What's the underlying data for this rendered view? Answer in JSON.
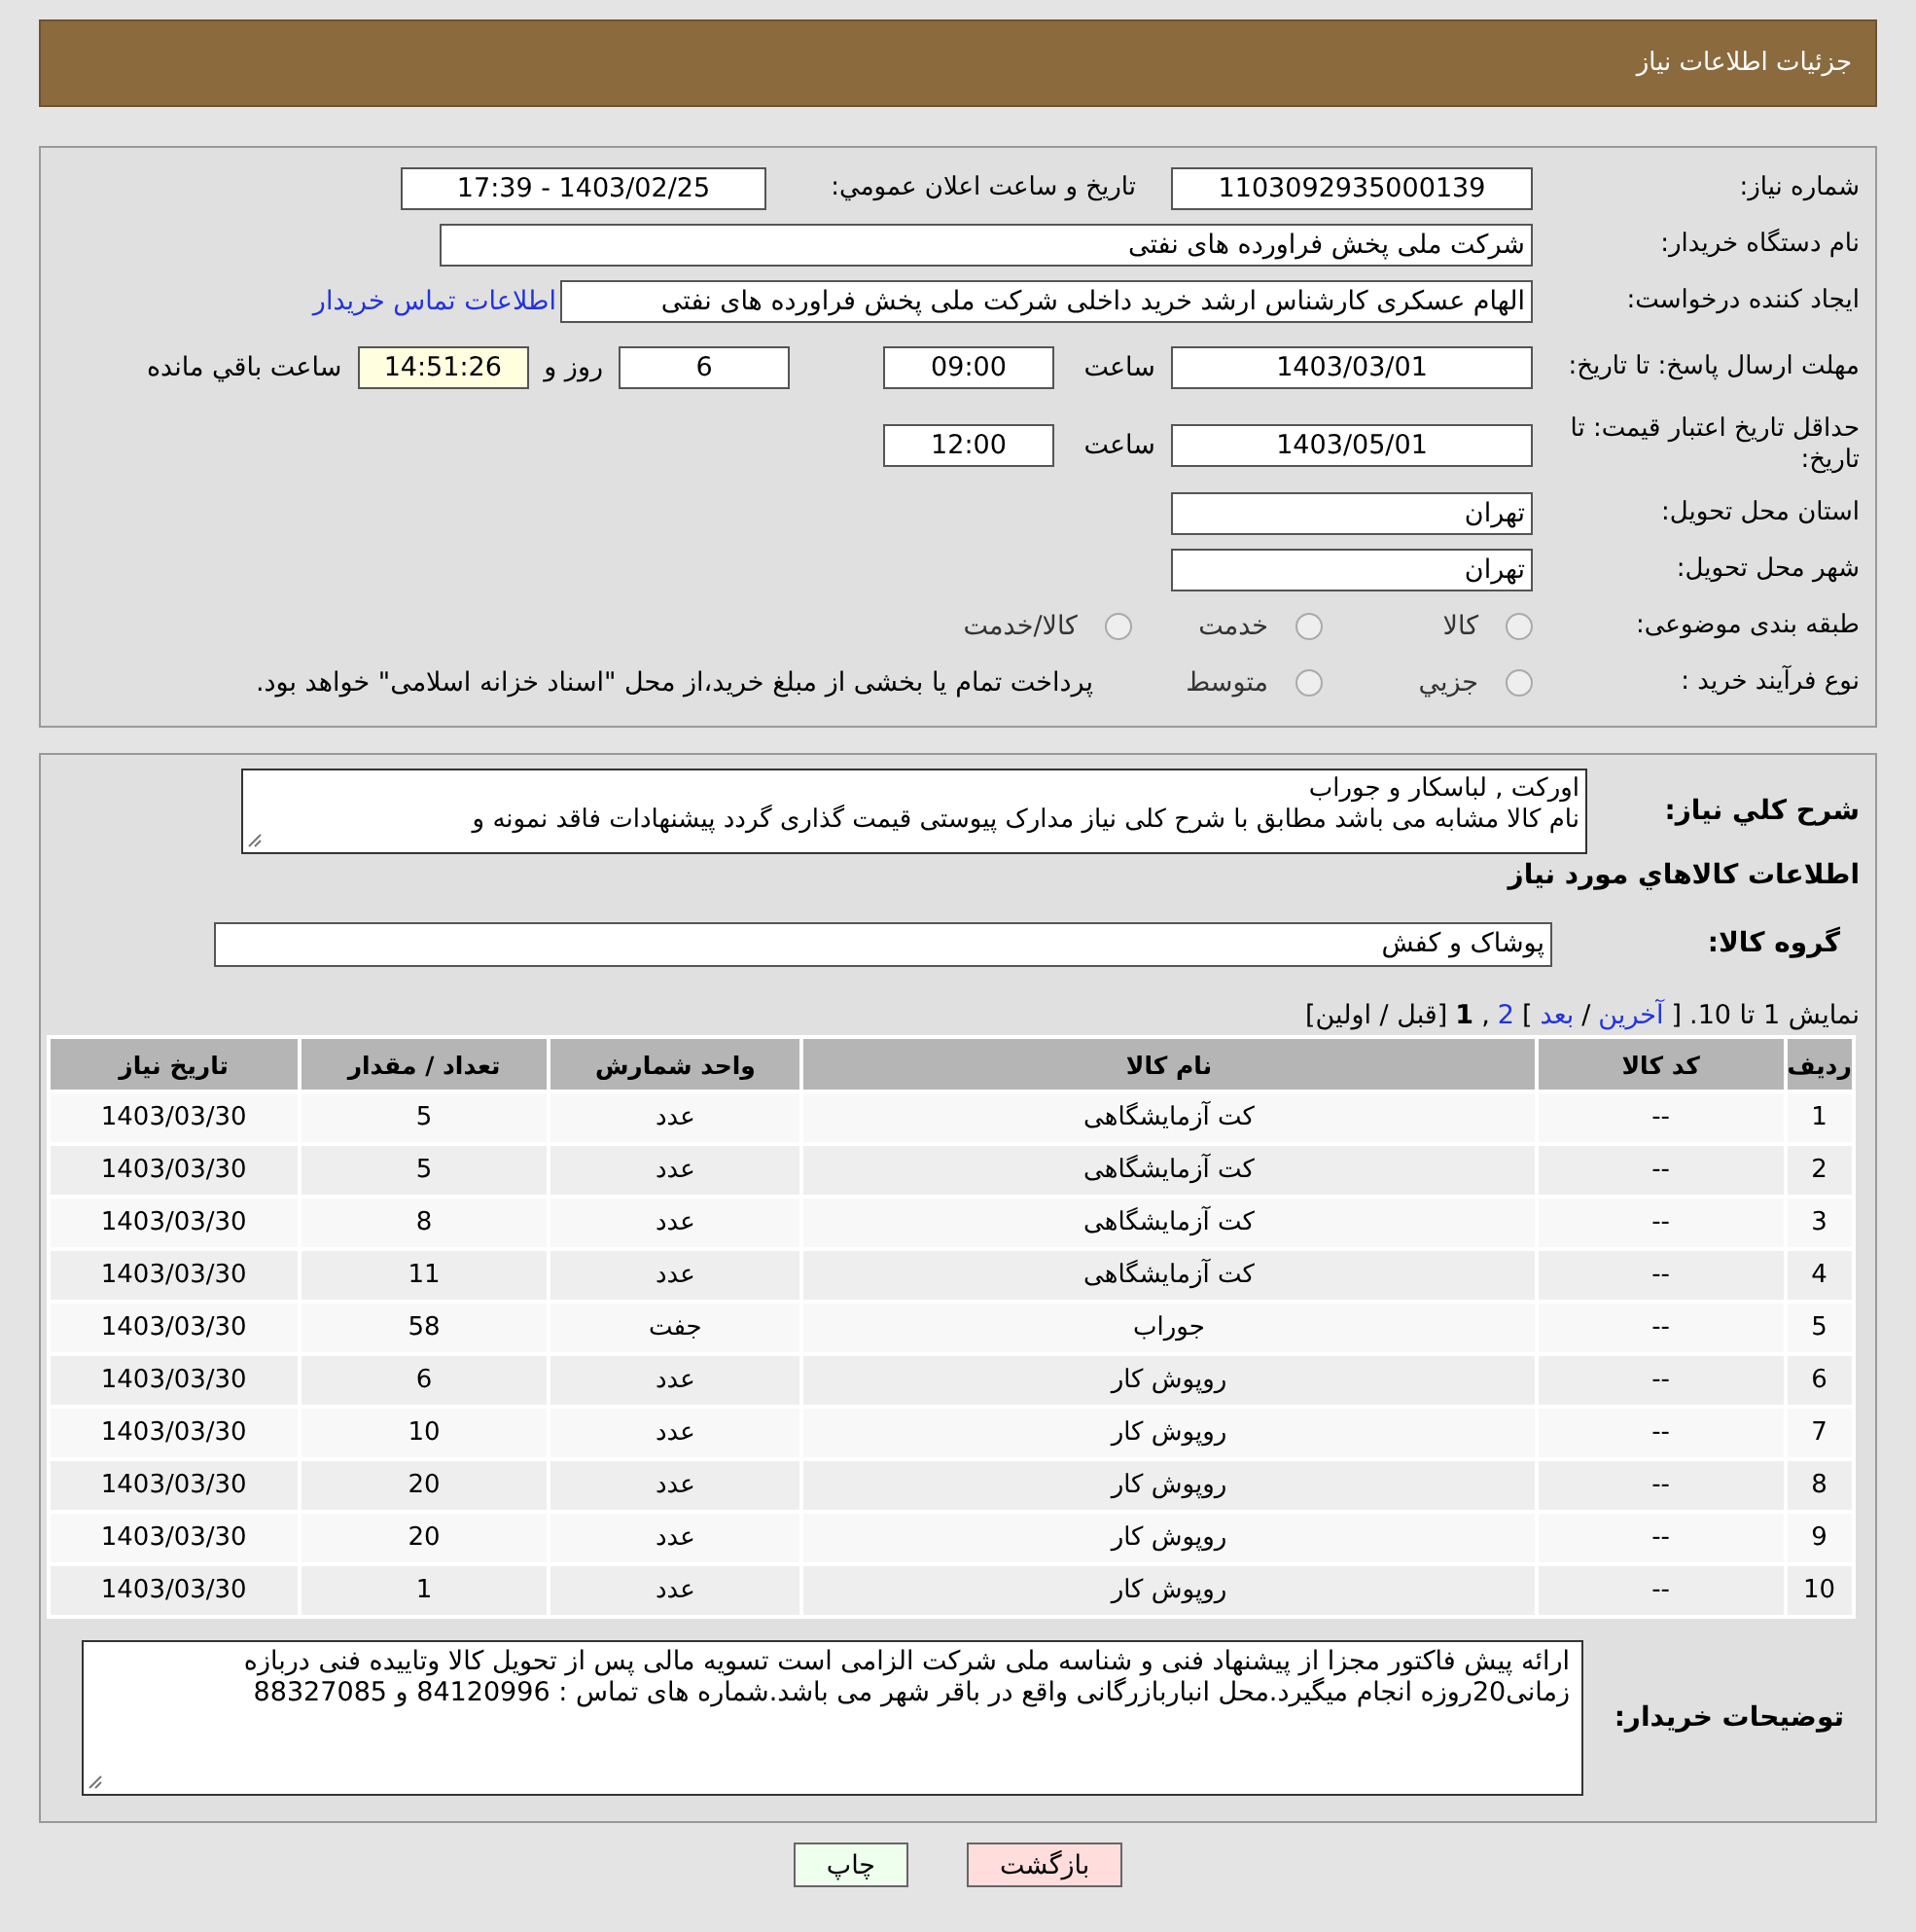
{
  "header": {
    "title": "جزئیات اطلاعات نیاز"
  },
  "details": {
    "need_number": {
      "label": "شماره نیاز:",
      "value": "1103092935000139"
    },
    "announce": {
      "label": "تاریخ و ساعت اعلان عمومي:",
      "value": "1403/02/25 - 17:39"
    },
    "buyer_org": {
      "label": "نام دستگاه خریدار:",
      "value": "شرکت ملی پخش فراورده های نفتی"
    },
    "creator": {
      "label": "ایجاد کننده درخواست:",
      "value": "الهام عسکری کارشناس ارشد خرید داخلی شرکت ملی پخش فراورده های نفتی",
      "link": "اطلاعات تماس خریدار"
    },
    "reply_deadline": {
      "label": "مهلت ارسال پاسخ: تا تاریخ:",
      "date": "1403/03/01",
      "time_label": "ساعت",
      "time": "09:00",
      "days": "6",
      "days_label": "روز و",
      "remaining": "14:51:26",
      "remaining_label": "ساعت باقي مانده"
    },
    "price_validity": {
      "label": "حداقل تاریخ اعتبار قیمت: تا تاریخ:",
      "date": "1403/05/01",
      "time_label": "ساعت",
      "time": "12:00"
    },
    "province": {
      "label": "استان محل تحویل:",
      "value": "تهران"
    },
    "city": {
      "label": "شهر محل تحویل:",
      "value": "تهران"
    },
    "category": {
      "label": "طبقه بندی موضوعی:",
      "options": [
        {
          "label": "کالا",
          "selected": false
        },
        {
          "label": "خدمت",
          "selected": false
        },
        {
          "label": "کالا/خدمت",
          "selected": false
        }
      ]
    },
    "purchase_type": {
      "label": "نوع فرآیند خرید :",
      "options": [
        {
          "label": "جزيي",
          "selected": false
        },
        {
          "label": "متوسط",
          "selected": false
        }
      ],
      "note": "پرداخت تمام یا بخشی از مبلغ خرید،از محل \"اسناد خزانه اسلامی\" خواهد بود."
    }
  },
  "items_section": {
    "summary": {
      "label": "شرح کلي نیاز:",
      "lines": [
        "اورکت , لباسکار و جوراب",
        "نام کالا مشابه می باشد مطابق با شرح کلی نیاز مدارک پیوستی قیمت گذاری گردد پیشنهادات فاقد نمونه و"
      ]
    },
    "title": "اطلاعات کالاهاي مورد نیاز",
    "group": {
      "label": "گروه کالا:",
      "value": "پوشاک و کفش"
    },
    "pagination": [
      {
        "text": "نمایش 1 تا 10.",
        "kind": "plain"
      },
      {
        "text": "[",
        "kind": "plain"
      },
      {
        "text": "آخرین",
        "kind": "link"
      },
      {
        "text": "/",
        "kind": "plain"
      },
      {
        "text": "بعد",
        "kind": "link"
      },
      {
        "text": "]",
        "kind": "plain"
      },
      {
        "text": "2",
        "kind": "link"
      },
      {
        "text": ",",
        "kind": "plain"
      },
      {
        "text": "1",
        "kind": "current"
      },
      {
        "text": "[قبل / اولین]",
        "kind": "plain"
      }
    ],
    "table": {
      "columns": [
        "ردیف",
        "کد کالا",
        "نام کالا",
        "واحد شمارش",
        "تعداد / مقدار",
        "تاریخ نیاز"
      ],
      "rows": [
        [
          "1",
          "--",
          "کت آزمایشگاهی",
          "عدد",
          "5",
          "1403/03/30"
        ],
        [
          "2",
          "--",
          "کت آزمایشگاهی",
          "عدد",
          "5",
          "1403/03/30"
        ],
        [
          "3",
          "--",
          "کت آزمایشگاهی",
          "عدد",
          "8",
          "1403/03/30"
        ],
        [
          "4",
          "--",
          "کت آزمایشگاهی",
          "عدد",
          "11",
          "1403/03/30"
        ],
        [
          "5",
          "--",
          "جوراب",
          "جفت",
          "58",
          "1403/03/30"
        ],
        [
          "6",
          "--",
          "روپوش کار",
          "عدد",
          "6",
          "1403/03/30"
        ],
        [
          "7",
          "--",
          "روپوش کار",
          "عدد",
          "10",
          "1403/03/30"
        ],
        [
          "8",
          "--",
          "روپوش کار",
          "عدد",
          "20",
          "1403/03/30"
        ],
        [
          "9",
          "--",
          "روپوش کار",
          "عدد",
          "20",
          "1403/03/30"
        ],
        [
          "10",
          "--",
          "روپوش کار",
          "عدد",
          "1",
          "1403/03/30"
        ]
      ]
    },
    "buyer_notes": {
      "label": "توضیحات خریدار:",
      "text": "ارائه پیش فاکتور مجزا از پیشنهاد فنی و شناسه ملی شرکت الزامی است تسویه مالی پس از تحویل کالا وتاییده فنی دربازه زمانی20روزه انجام میگیرد.محل انباربازرگانی واقع در باقر شهر می باشد.شماره های تماس : 84120996 و 88327085"
    }
  },
  "buttons": [
    {
      "label": "بازگشت",
      "kind": "back"
    },
    {
      "label": "چاپ",
      "kind": "print"
    }
  ]
}
